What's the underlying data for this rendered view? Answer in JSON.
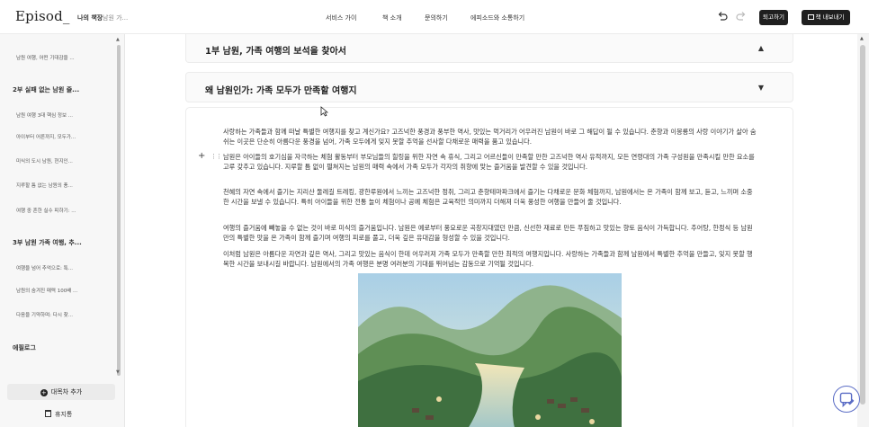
{
  "app": {
    "logo": "Episod_",
    "breadcrumb": [
      "나의 책장",
      "/",
      "남원 가..."
    ]
  },
  "nav": [
    "서비스 가이",
    "책 소개",
    "문의하기",
    "에피소드와 소통하기"
  ],
  "actions": {
    "exit_label": "퇴고하기",
    "export_label": "책 내보내기"
  },
  "sidebar": {
    "items": [
      {
        "type": "item",
        "label": "남원 여행, 어떤 기대감을 ..."
      },
      {
        "type": "head",
        "label": "2부 실패 없는 남원 즐..."
      },
      {
        "type": "item",
        "label": "남원 여행 3대 핵심 정보 ..."
      },
      {
        "type": "item",
        "label": "아이부터 어른까지, 모두가..."
      },
      {
        "type": "item",
        "label": "미식의 도시 남원, 현지인..."
      },
      {
        "type": "item",
        "label": "지루할 틈 없는 남원의 풍..."
      },
      {
        "type": "item",
        "label": "여행 중 흔한 실수 피하기: ..."
      },
      {
        "type": "head",
        "label": "3부 남원 가족 여행, 추..."
      },
      {
        "type": "item",
        "label": "여행을 넘어 추억으로: 특..."
      },
      {
        "type": "item",
        "label": "남원의 숨겨진 매력 100배 ..."
      },
      {
        "type": "item",
        "label": "다음을 기약하며: 다시 찾..."
      },
      {
        "type": "head",
        "label": "에필로그"
      }
    ],
    "add_toc_label": "대목차 추가",
    "trash_label": "휴지통"
  },
  "sections": [
    {
      "title": "1부 남원, 가족 여행의 보석을 찾아서",
      "expanded": true
    },
    {
      "title": "왜 남원인가: 가족 모두가 만족할 여행지",
      "expanded": false
    }
  ],
  "content": {
    "paragraphs": [
      "사랑하는 가족들과 함께 떠날 특별한 여행지를 찾고 계신가요? 고즈넉한 풍경과 풍부한 역사, 맛있는 먹거리가 어우러진 남원이 바로 그 해답이 될 수 있습니다. 춘향과 이몽룡의 사랑 이야기가 살아 숨 쉬는 이곳은 단순히 아름다운 풍경을 넘어, 가족 모두에게 잊지 못할 추억을 선사할 다채로운 매력을 품고 있습니다.",
      "남원은 아이들의 호기심을 자극하는 체험 활동부터 부모님들의 힐링을 위한 자연 속 휴식, 그리고 어르신들이 만족할 만한 고즈넉한 역사 유적까지, 모든 연령대의 가족 구성원을 만족시킬 만한 요소를 고루 갖추고 있습니다. 지루할 틈 없이 펼쳐지는 남원의 매력 속에서 가족 모두가 각자의 취향에 맞는 즐거움을 발견할 수 있을 것입니다.",
      "천혜의 자연 속에서 즐기는 지리산 둘레길 트레킹, 광한루원에서 느끼는 고즈넉한 정취, 그리고 춘향테마파크에서 즐기는 다채로운 문화 체험까지, 남원에서는 온 가족이 함께 보고, 듣고, 느끼며 소중한 시간을 보낼 수 있습니다. 특히 아이들을 위한 전통 놀이 체험이나 공예 체험은 교육적인 의미까지 더해져 더욱 풍성한 여행을 만들어 줄 것입니다.",
      "여행의 즐거움에 빼놓을 수 없는 것이 바로 미식의 즐거움입니다. 남원은 예로부터 풍요로운 곡창지대였던 만큼, 신선한 재료로 만든 푸짐하고 맛있는 향토 음식이 가득합니다. 추어탕, 한정식 등 남원만의 특별한 맛을 온 가족이 함께 즐기며 여행의 피로를 풀고, 더욱 깊은 유대감을 형성할 수 있을 것입니다.",
      "이처럼 남원은 아름다운 자연과 깊은 역사, 그리고 맛있는 음식이 한데 어우러져 가족 모두가 만족할 만한 최적의 여행지입니다. 사랑하는 가족들과 함께 남원에서 특별한 추억을 만들고, 잊지 못할 행복한 시간을 보내시길 바랍니다. 남원에서의 가족 여행은 분명 여러분의 기대를 뛰어넘는 감동으로 기억될 것입니다."
    ]
  },
  "colors": {
    "accent_dark": "#1f1f1f",
    "spell_underline": "#e05050",
    "chat_icon": "#5a6cc5"
  }
}
